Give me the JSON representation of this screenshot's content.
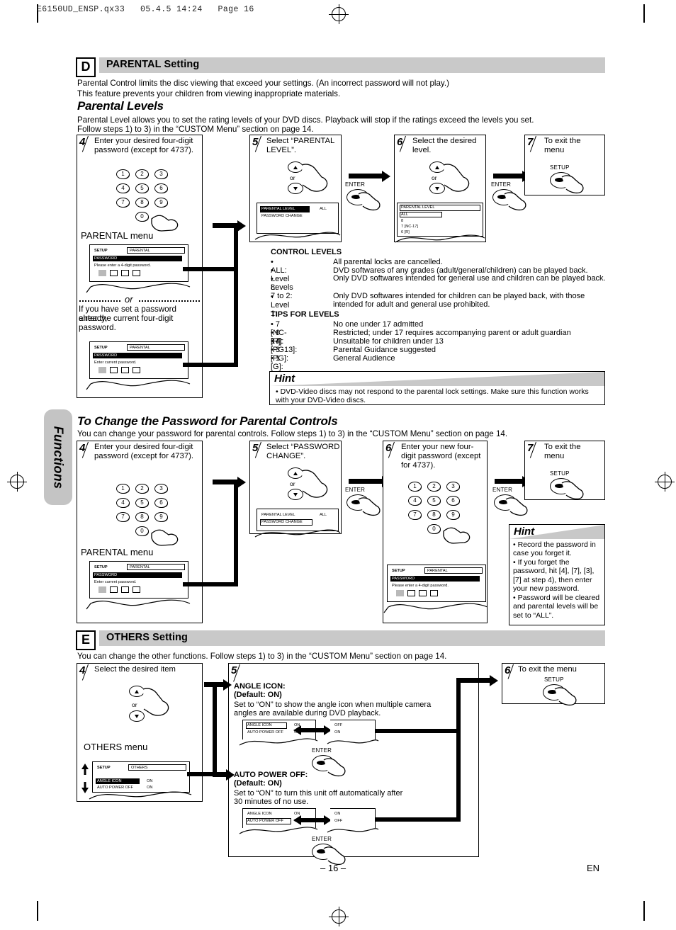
{
  "page": {
    "file_header": "E6150UD_ENSP.qx33   05.4.5 14:24   Page 16",
    "side_tab": "Functions",
    "page_number": "– 16 –",
    "lang_code": "EN"
  },
  "section_d": {
    "letter": "D",
    "title": "PARENTAL Setting",
    "intro_line1": "Parental Control limits the disc viewing that exceed your settings. (An incorrect password will not play.)",
    "intro_line2": "This feature prevents your children from viewing inappropriate materials.",
    "sub_title": "Parental Levels",
    "sub_line1": "Parental Level allows you to set the rating levels of your DVD discs. Playback will stop if the ratings exceed the levels you set.",
    "sub_line2": "Follow steps 1) to 3) in the “CUSTOM Menu” section on page 14.",
    "steps": [
      {
        "num": "4",
        "text": "Enter your desired four-digit password (except for 4737)."
      },
      {
        "num": "5",
        "text": "Select “PARENTAL LEVEL”."
      },
      {
        "num": "6",
        "text": "Select the desired level."
      },
      {
        "num": "7",
        "text": "To exit the menu"
      }
    ],
    "parental_menu_label": "PARENTAL menu",
    "or_label": "or",
    "alt_note_line1": "If you have set a password already,",
    "alt_note_line2": "enter the current four-digit",
    "alt_note_line3": "password.",
    "osd_password_1": {
      "setup": "SETUP",
      "tab": "PARENTAL",
      "heading": "PASSWORD",
      "prompt": "Please enter a 4-digit password."
    },
    "osd_password_2": {
      "setup": "SETUP",
      "tab": "PARENTAL",
      "heading": "PASSWORD",
      "prompt": "Enter current password."
    },
    "osd_level_menu": {
      "item1": "PARENTAL LEVEL",
      "item1_value": "ALL",
      "item2": "PASSWORD CHANGE"
    },
    "osd_level_list": {
      "heading": "PARENTAL LEVEL",
      "items": [
        "ALL",
        "8",
        "7 [NC-17]",
        "6 [R]"
      ]
    },
    "enter_label": "ENTER",
    "setup_label": "SETUP",
    "control_levels": {
      "title": "CONTROL LEVELS",
      "rows": [
        {
          "term": "• ALL:",
          "desc": "All parental locks are cancelled."
        },
        {
          "term": "• Level 8:",
          "desc": "DVD softwares of any grades (adult/general/children) can be played back."
        },
        {
          "term": "• Levels 7 to 2:",
          "desc": "Only DVD softwares intended for general use and children can be played back."
        },
        {
          "term": "• Level 1:",
          "desc": "Only DVD softwares intended for children can be played back, with those intended for adult and general use prohibited."
        }
      ]
    },
    "tips_for_levels": {
      "title": "TIPS FOR LEVELS",
      "rows": [
        {
          "term": "• 7 [NC-17]:",
          "desc": "No one under 17 admitted"
        },
        {
          "term": "• 6 [R]:",
          "desc": "Restricted; under 17 requires accompanying parent or adult guardian"
        },
        {
          "term": "• 4 [PG13]:",
          "desc": "Unsuitable for children under 13"
        },
        {
          "term": "• 3 [PG]:",
          "desc": "Parental Guidance suggested"
        },
        {
          "term": "• 1 [G]:",
          "desc": "General Audience"
        }
      ]
    },
    "hint": {
      "title": "Hint",
      "body": "• DVD-Video discs may not respond to the parental lock settings. Make sure this function works with your DVD-Video discs."
    }
  },
  "password_change": {
    "title": "To Change the Password for Parental Controls",
    "intro": "You can change your password for parental controls.  Follow steps 1) to 3) in the “CUSTOM Menu” section on page 14.",
    "steps": [
      {
        "num": "4",
        "text": "Enter your desired four-digit password (except for 4737)."
      },
      {
        "num": "5",
        "text": "Select “PASSWORD CHANGE”."
      },
      {
        "num": "6",
        "text": "Enter your new four-digit password (except for 4737)."
      },
      {
        "num": "7",
        "text": "To exit the menu"
      }
    ],
    "parental_menu_label": "PARENTAL menu",
    "osd_current": {
      "setup": "SETUP",
      "tab": "PARENTAL",
      "heading": "PASSWORD",
      "prompt": "Enter current password."
    },
    "osd_level_menu": {
      "item1": "PARENTAL LEVEL",
      "item1_value": "ALL",
      "item2": "PASSWORD CHANGE"
    },
    "osd_new": {
      "setup": "SETUP",
      "tab": "PARENTAL",
      "heading": "PASSWORD",
      "prompt": "Please enter a 4-digit password."
    },
    "enter_label": "ENTER",
    "setup_label": "SETUP",
    "hint": {
      "title": "Hint",
      "bullets": [
        "• Record the password in case you forget it.",
        "• If you forget the password, hit [4], [7], [3], [7] at step 4), then enter your new password.",
        "• Password will be cleared and parental levels will be set to “ALL”."
      ]
    }
  },
  "section_e": {
    "letter": "E",
    "title": "OTHERS Setting",
    "intro": "You can change the other functions. Follow steps 1) to 3) in the “CUSTOM Menu” section on page 14.",
    "steps": [
      {
        "num": "4",
        "text": "Select the desired item"
      },
      {
        "num": "5",
        "text": ""
      },
      {
        "num": "6",
        "text": "To exit the menu"
      }
    ],
    "others_menu_label": "OTHERS menu",
    "or_label": "or",
    "setup_label": "SETUP",
    "enter_label": "ENTER",
    "osd_others": {
      "setup": "SETUP",
      "tab": "OTHERS",
      "row1": "ANGLE ICON",
      "row1_value": "ON",
      "row2": "AUTO POWER OFF",
      "row2_value": "ON"
    },
    "angle_icon": {
      "title": "ANGLE ICON:",
      "default": "(Default: ON)",
      "desc_line1": "Set to “ON” to show the angle icon when multiple camera",
      "desc_line2": "angles are available during DVD playback.",
      "before": {
        "row1": "ANGLE ICON",
        "row1_value": "ON",
        "row2": "AUTO POWER OFF",
        "row2_value": "ON"
      },
      "after": {
        "row1_value": "OFF",
        "row2_value": "ON"
      }
    },
    "auto_power_off": {
      "title": "AUTO POWER OFF:",
      "default": "(Default: ON)",
      "desc_line1": "Set to “ON” to turn this unit off automatically after",
      "desc_line2": "30 minutes of no use.",
      "before": {
        "row1": "ANGLE ICON",
        "row1_value": "ON",
        "row2": "AUTO POWER OFF",
        "row2_value": "ON"
      },
      "after": {
        "row1_value": "ON",
        "row2_value": "OFF"
      }
    }
  },
  "keypad": {
    "keys": [
      "1",
      "2",
      "3",
      "4",
      "5",
      "6",
      "7",
      "8",
      "9",
      "0"
    ]
  },
  "colors": {
    "bar_gray": "#c9c9c9",
    "bar_shadow": "#8f8f8f",
    "tab_gray": "#c4c4c4"
  }
}
